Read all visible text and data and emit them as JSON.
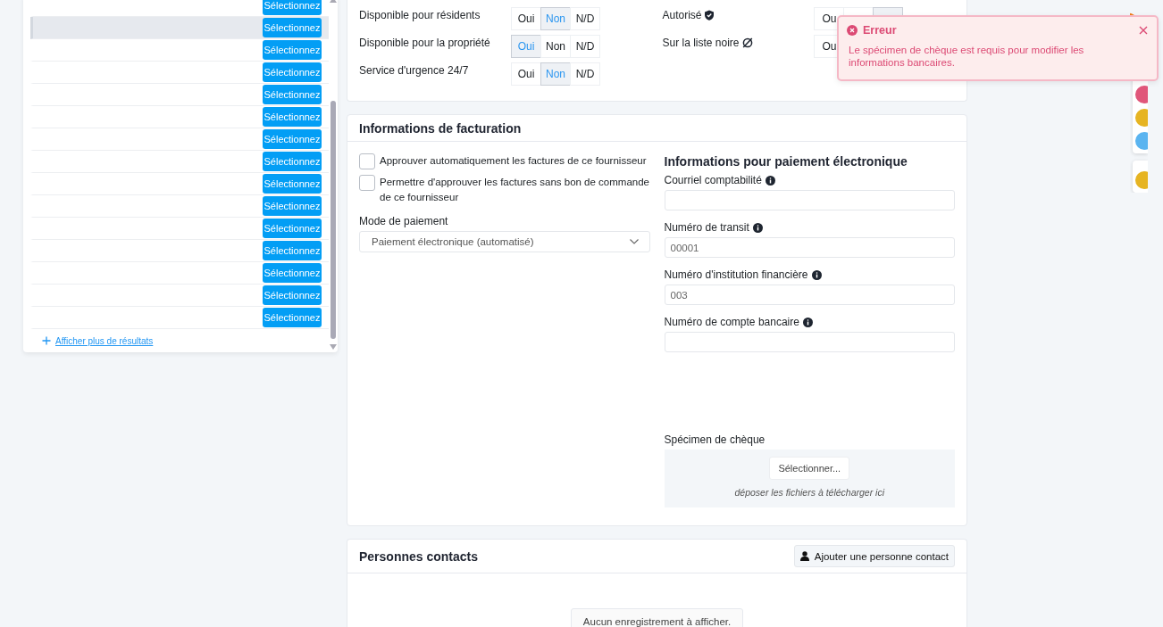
{
  "search_results": {
    "rows": [
      {
        "button": "Sélectionnez",
        "highlighted": false
      },
      {
        "button": "Sélectionnez",
        "highlighted": true
      },
      {
        "button": "Sélectionnez",
        "highlighted": false
      },
      {
        "button": "Sélectionnez",
        "highlighted": false
      },
      {
        "button": "Sélectionnez",
        "highlighted": false
      },
      {
        "button": "Sélectionnez",
        "highlighted": false
      },
      {
        "button": "Sélectionnez",
        "highlighted": false
      },
      {
        "button": "Sélectionnez",
        "highlighted": false
      },
      {
        "button": "Sélectionnez",
        "highlighted": false
      },
      {
        "button": "Sélectionnez",
        "highlighted": false
      },
      {
        "button": "Sélectionnez",
        "highlighted": false
      },
      {
        "button": "Sélectionnez",
        "highlighted": false
      },
      {
        "button": "Sélectionnez",
        "highlighted": false
      },
      {
        "button": "Sélectionnez",
        "highlighted": false
      },
      {
        "button": "Sélectionnez",
        "highlighted": false
      }
    ],
    "more_link": "Afficher plus de résultats"
  },
  "availability": {
    "left": [
      {
        "label": "Disponible pour résidents",
        "options": [
          {
            "label": "Oui",
            "selected": false
          },
          {
            "label": "Non",
            "selected": true
          },
          {
            "label": "N/D",
            "selected": false
          }
        ]
      },
      {
        "label": "Disponible pour la propriété",
        "options": [
          {
            "label": "Oui",
            "selected": true
          },
          {
            "label": "Non",
            "selected": false
          },
          {
            "label": "N/D",
            "selected": false
          }
        ]
      },
      {
        "label": "Service d'urgence 24/7",
        "options": [
          {
            "label": "Oui",
            "selected": false
          },
          {
            "label": "Non",
            "selected": true
          },
          {
            "label": "N/D",
            "selected": false
          }
        ]
      }
    ],
    "right": [
      {
        "label": "Autorisé",
        "options": [
          {
            "label": "Ou",
            "selected": false
          },
          {
            "selected": false
          },
          {
            "selected": true
          }
        ]
      },
      {
        "label": "Sur la liste noire",
        "options": [
          {
            "label": "Ou",
            "selected": false
          }
        ]
      }
    ]
  },
  "billing": {
    "title": "Informations de facturation",
    "checkboxes": [
      {
        "label": "Approuver automatiquement les factures de ce fournisseur",
        "checked": false
      },
      {
        "label": "Permettre d'approuver les factures sans bon de commande de ce fournisseur",
        "checked": false
      }
    ],
    "payment_mode": {
      "label": "Mode de paiement",
      "value": "Paiement électronique (automatisé)"
    },
    "electronic": {
      "title": "Informations pour paiement électronique",
      "fields": [
        {
          "label": "Courriel comptabilité"
        },
        {
          "label": "Numéro de transit",
          "placeholder": "00001"
        },
        {
          "label": "Numéro d'institution financière",
          "placeholder": "003"
        },
        {
          "label": "Numéro de compte bancaire"
        }
      ],
      "cheque": {
        "label": "Spécimen de chèque",
        "button": "Sélectionner...",
        "hint": "déposer les fichiers à télécharger ici"
      }
    }
  },
  "contacts": {
    "title": "Personnes contacts",
    "add_button": "Ajouter une personne contact",
    "empty": "Aucun enregistrement à afficher."
  },
  "toast": {
    "title": "Erreur",
    "message": "Le spécimen de chèque est requis pour modifier les informations bancaires."
  },
  "side_badges": [
    {
      "color": "#e0567a"
    },
    {
      "color": "#e6b422"
    },
    {
      "color": "#5ab4f0"
    },
    {
      "color": "#e6b422"
    }
  ]
}
